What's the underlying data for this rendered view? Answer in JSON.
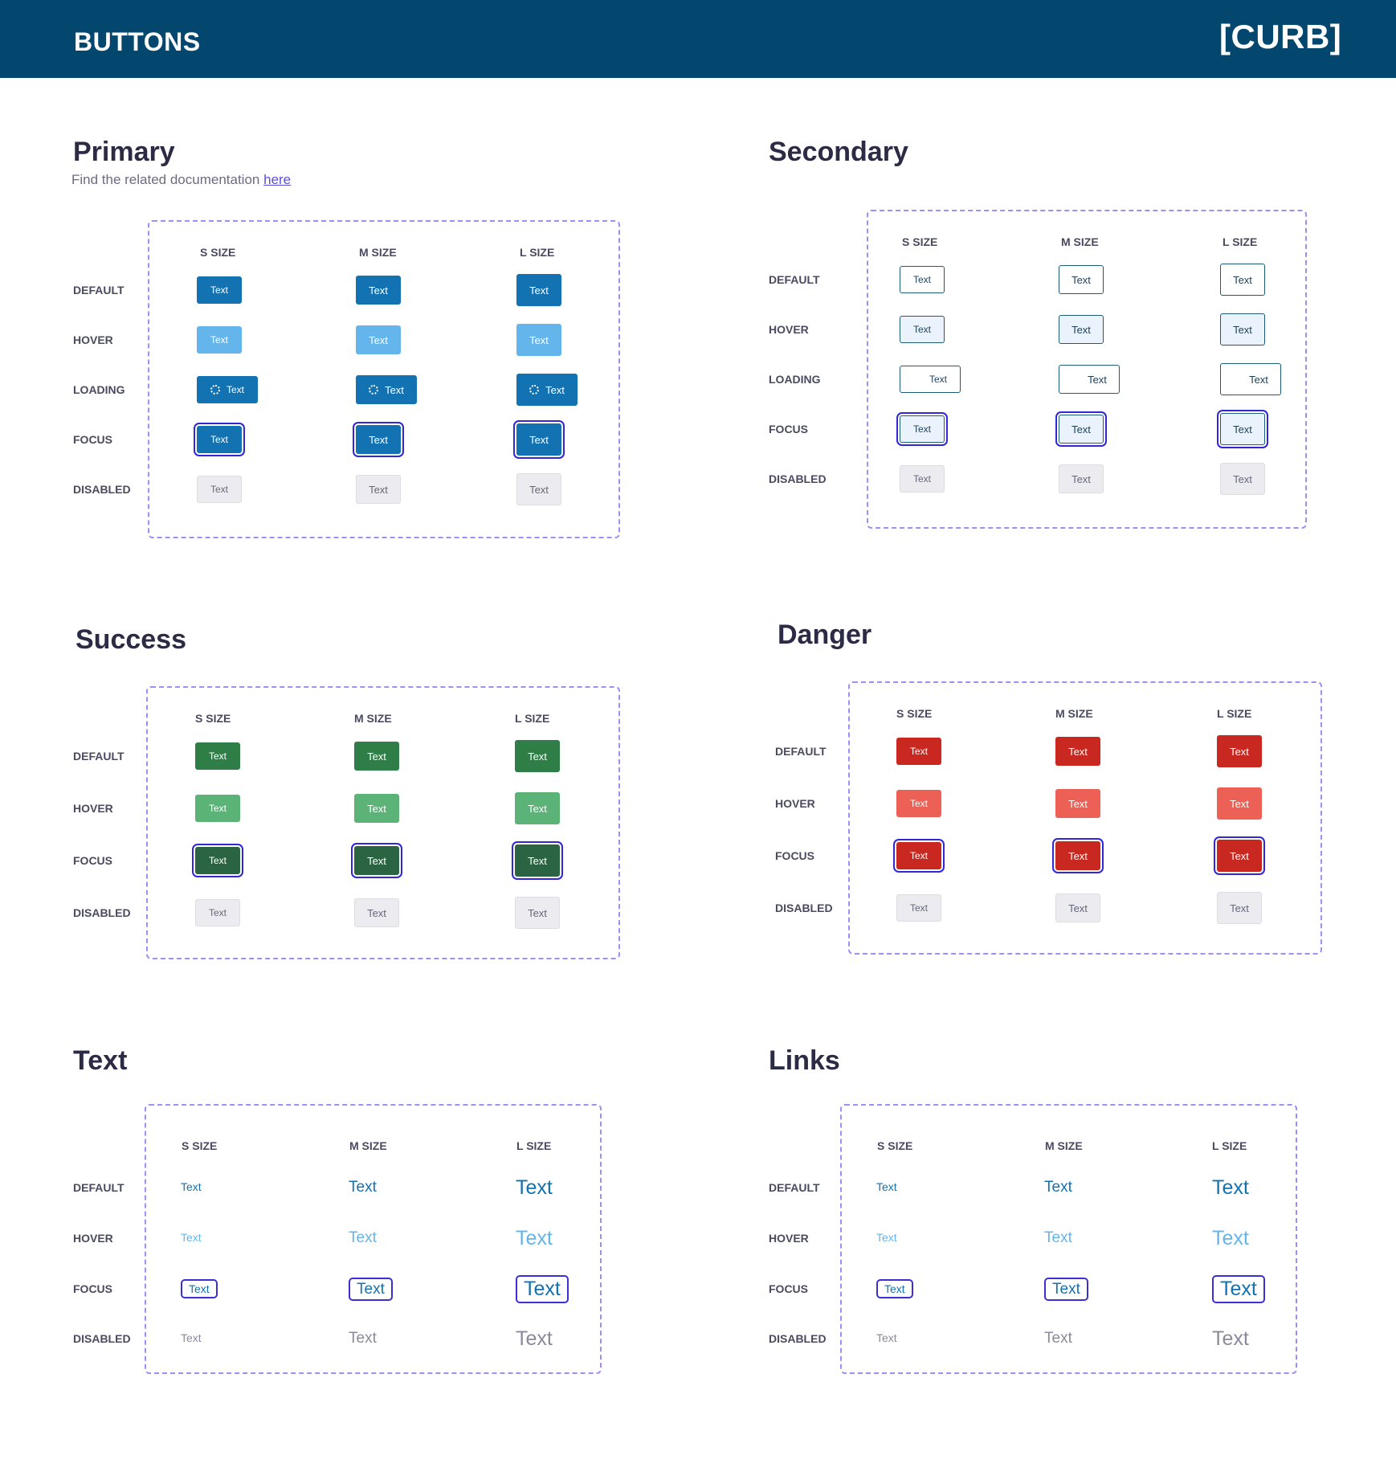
{
  "header": {
    "title": "BUTTONS",
    "logo": "[CURB]"
  },
  "colors": {
    "header_bg": "#03476f",
    "primary": "#1272b2",
    "primary_hover": "#64b5ec",
    "secondary_border": "#1e5a7a",
    "secondary_hover_bg": "#eaf3fb",
    "success": "#2f7d47",
    "success_hover": "#5bb377",
    "success_focus": "#2b6442",
    "danger": "#c8281f",
    "danger_hover": "#ec6055",
    "disabled_bg": "#ececf0",
    "disabled_text": "#66667a",
    "focus_ring": "#3127d9",
    "dashed_border": "#a38cf2",
    "link": "#1272b2",
    "link_hover": "#64b5ec",
    "link_disabled": "#8a8a9c"
  },
  "sizes": [
    "S SIZE",
    "M SIZE",
    "L SIZE"
  ],
  "button_label": "Text",
  "primary": {
    "title": "Primary",
    "subtitle": "Find the related documentation ",
    "subtitle_link": "here",
    "rows": [
      "DEFAULT",
      "HOVER",
      "LOADING",
      "FOCUS",
      "DISABLED"
    ]
  },
  "secondary": {
    "title": "Secondary",
    "rows": [
      "DEFAULT",
      "HOVER",
      "LOADING",
      "FOCUS",
      "DISABLED"
    ]
  },
  "success": {
    "title": "Success",
    "rows": [
      "DEFAULT",
      "HOVER",
      "FOCUS",
      "DISABLED"
    ]
  },
  "danger": {
    "title": "Danger",
    "rows": [
      "DEFAULT",
      "HOVER",
      "FOCUS",
      "DISABLED"
    ]
  },
  "text": {
    "title": "Text",
    "rows": [
      "DEFAULT",
      "HOVER",
      "FOCUS",
      "DISABLED"
    ]
  },
  "links": {
    "title": "Links",
    "rows": [
      "DEFAULT",
      "HOVER",
      "FOCUS",
      "DISABLED"
    ]
  }
}
